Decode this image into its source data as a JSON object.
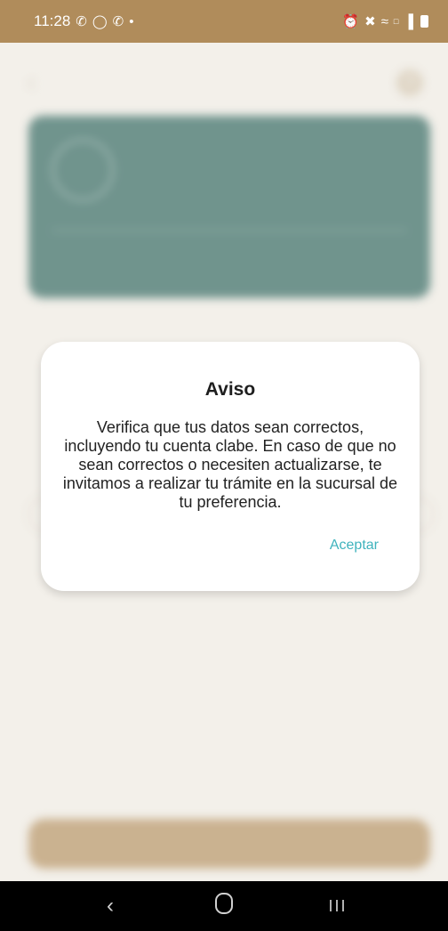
{
  "status_bar": {
    "time": "11:28",
    "left_icons": [
      "phone-icon",
      "whatsapp-icon",
      "phone-icon",
      "dot"
    ],
    "right_icons": [
      "alarm-icon",
      "mute-icon",
      "wifi-icon",
      "volte-icon",
      "signal-icon",
      "battery-icon"
    ]
  },
  "dialog": {
    "title": "Aviso",
    "body": "Verifica que tus datos sean correctos, incluyendo tu cuenta clabe. En caso de que no sean correctos o necesiten actualizarse, te invitamos a realizar tu trámite en la sucursal de tu preferencia.",
    "accept_label": "Aceptar"
  },
  "colors": {
    "status_bar": "#b08c5b",
    "card": "#2f6760",
    "accent": "#3fb3bd",
    "button": "#b99564"
  },
  "nav_bar": {
    "back_icon": "back-icon",
    "home_icon": "home-icon",
    "recents_icon": "recents-icon"
  }
}
